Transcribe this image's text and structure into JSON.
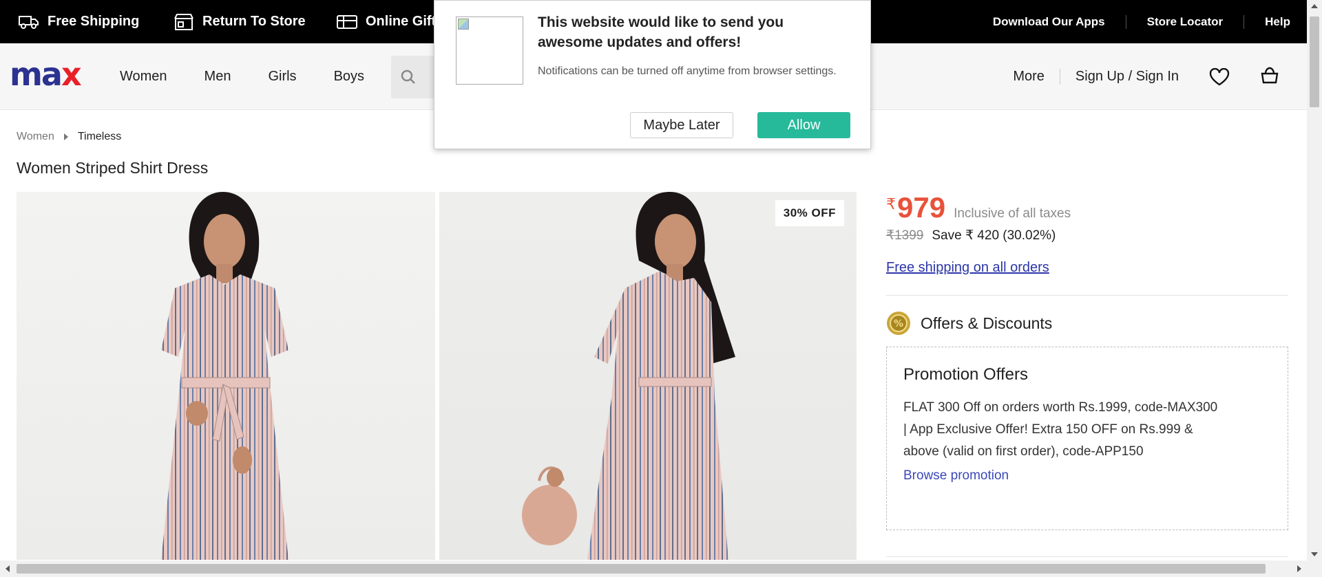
{
  "topbar": {
    "promos": [
      "Free Shipping",
      "Return To Store",
      "Online Gift"
    ],
    "links": [
      "Download Our Apps",
      "Store Locator",
      "Help"
    ]
  },
  "header": {
    "logo_left": "ma",
    "logo_right": "x",
    "nav": [
      "Women",
      "Men",
      "Girls",
      "Boys"
    ],
    "more": "More",
    "signin": "Sign Up / Sign In"
  },
  "breadcrumb": [
    "Women",
    "Timeless"
  ],
  "product": {
    "title": "Women Striped Shirt Dress",
    "discount_badge": "30% OFF",
    "currency_symbol": "₹",
    "price": "979",
    "tax_note": "Inclusive of all taxes",
    "mrp": "₹1399",
    "save_text": "Save ₹ 420 (30.02%)",
    "shipping_link": "Free shipping on all orders"
  },
  "offers": {
    "heading": "Offers & Discounts",
    "promo_title": "Promotion Offers",
    "promo_text": "FLAT 300 Off on orders worth Rs.1999, code-MAX300 | App Exclusive Offer! Extra 150 OFF on Rs.999 & above (valid on first order), code-APP150",
    "browse_link": "Browse promotion"
  },
  "popup": {
    "title": "This website would like to send you awesome updates and offers!",
    "subtitle": "Notifications can be turned off anytime from browser settings.",
    "later_label": "Maybe Later",
    "allow_label": "Allow"
  },
  "colors": {
    "brand_blue": "#2b3290",
    "brand_red": "#e8202a",
    "price_red": "#e8523a",
    "allow_green": "#26b99a",
    "link_blue": "#2b35a8"
  }
}
